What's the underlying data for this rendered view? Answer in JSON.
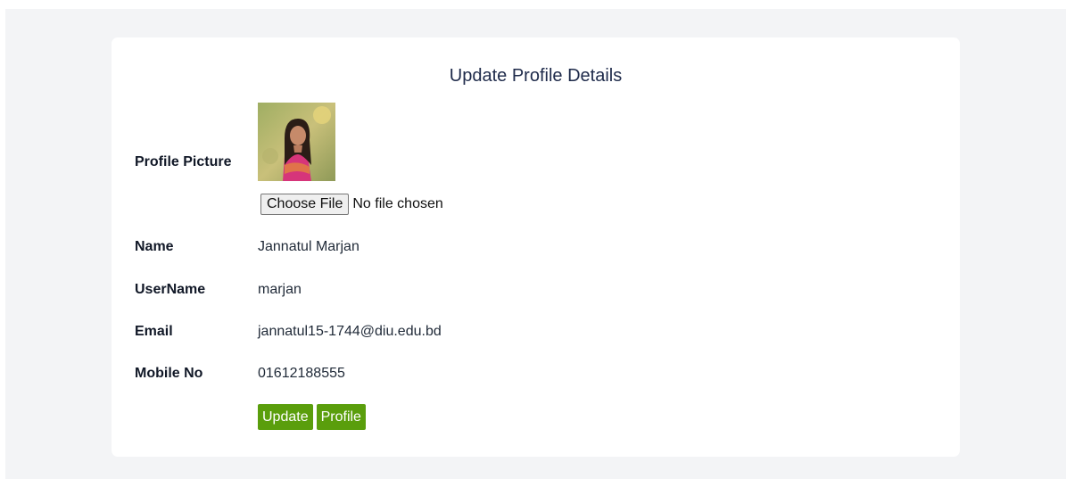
{
  "form": {
    "title": "Update Profile Details",
    "profile_picture_label": "Profile Picture",
    "file_input": {
      "button_label": "Choose File",
      "status": "No file chosen"
    },
    "fields": [
      {
        "label": "Name",
        "value": "Jannatul Marjan"
      },
      {
        "label": "UserName",
        "value": "marjan"
      },
      {
        "label": "Email",
        "value": "jannatul15-1744@diu.edu.bd"
      },
      {
        "label": "Mobile No",
        "value": "01612188555"
      }
    ],
    "buttons": {
      "update_label": "Update",
      "profile_label": "Profile"
    }
  },
  "colors": {
    "page_background": "#f3f4f6",
    "card_background": "#ffffff",
    "title_color": "#1e2a4a",
    "button_green": "#5a9e0c"
  }
}
